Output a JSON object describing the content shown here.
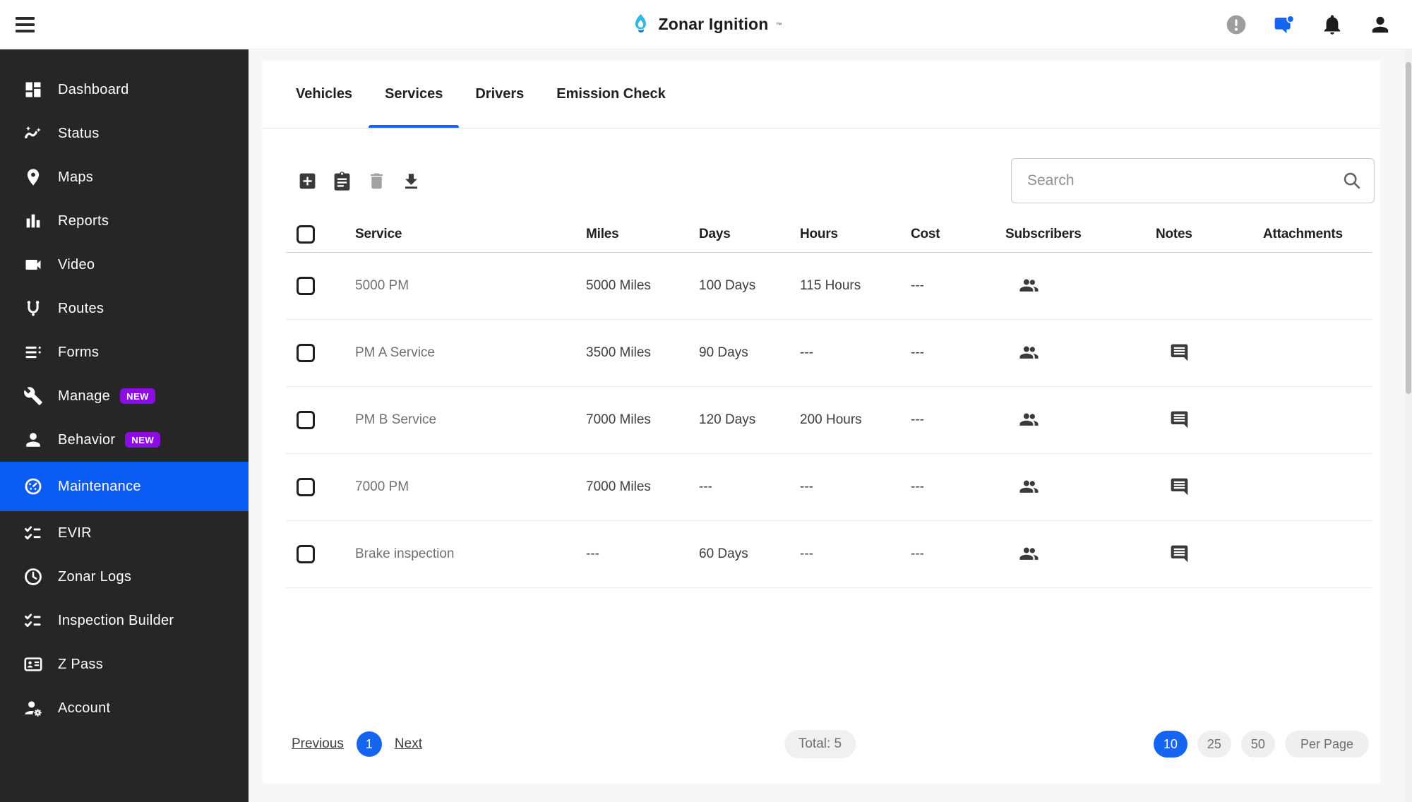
{
  "colors": {
    "sidebar_bg": "#262626",
    "active_item_blue": "#0b5bf5",
    "accent_blue": "#1565f0",
    "badge_purple": "#8c0ce4",
    "page_bg": "#f7f7f7"
  },
  "header": {
    "brand": "Zonar Ignition",
    "brand_mark": "™",
    "icons": [
      "menu-icon",
      "alert-icon",
      "chat-icon",
      "notifications-icon",
      "account-icon"
    ]
  },
  "sidebar": {
    "items": [
      {
        "label": "Dashboard",
        "icon": "dashboard-icon"
      },
      {
        "label": "Status",
        "icon": "status-icon"
      },
      {
        "label": "Maps",
        "icon": "map-pin-icon"
      },
      {
        "label": "Reports",
        "icon": "bar-chart-icon"
      },
      {
        "label": "Video",
        "icon": "video-camera-icon"
      },
      {
        "label": "Routes",
        "icon": "route-icon"
      },
      {
        "label": "Forms",
        "icon": "forms-list-icon"
      },
      {
        "label": "Manage",
        "icon": "wrench-icon",
        "badge": "NEW"
      },
      {
        "label": "Behavior",
        "icon": "person-icon",
        "badge": "NEW"
      },
      {
        "label": "Maintenance",
        "icon": "gauge-icon",
        "active": true
      },
      {
        "label": "EVIR",
        "icon": "checklist-icon"
      },
      {
        "label": "Zonar Logs",
        "icon": "clock-icon"
      },
      {
        "label": "Inspection Builder",
        "icon": "checklist-icon"
      },
      {
        "label": "Z Pass",
        "icon": "id-card-icon"
      },
      {
        "label": "Account",
        "icon": "person-gear-icon"
      }
    ]
  },
  "main": {
    "tabs": [
      {
        "label": "Vehicles"
      },
      {
        "label": "Services",
        "active": true
      },
      {
        "label": "Drivers"
      },
      {
        "label": "Emission Check"
      }
    ],
    "toolbar": {
      "icons": [
        "add-icon",
        "clipboard-icon",
        "trash-icon",
        "download-icon"
      ]
    },
    "search": {
      "placeholder": "Search"
    },
    "table": {
      "columns": [
        "Service",
        "Miles",
        "Days",
        "Hours",
        "Cost",
        "Subscribers",
        "Notes",
        "Attachments"
      ],
      "rows": [
        {
          "service": "5000 PM",
          "miles": "5000 Miles",
          "days": "100 Days",
          "hours": "115 Hours",
          "cost": "---",
          "has_subscribers": true,
          "has_notes": false,
          "has_attachments": false
        },
        {
          "service": "PM A Service",
          "miles": "3500 Miles",
          "days": "90 Days",
          "hours": "---",
          "cost": "---",
          "has_subscribers": true,
          "has_notes": true,
          "has_attachments": false
        },
        {
          "service": "PM B Service",
          "miles": "7000 Miles",
          "days": "120 Days",
          "hours": "200 Hours",
          "cost": "---",
          "has_subscribers": true,
          "has_notes": true,
          "has_attachments": false
        },
        {
          "service": "7000 PM",
          "miles": "7000 Miles",
          "days": "---",
          "hours": "---",
          "cost": "---",
          "has_subscribers": true,
          "has_notes": true,
          "has_attachments": false
        },
        {
          "service": "Brake inspection",
          "miles": "---",
          "days": "60 Days",
          "hours": "---",
          "cost": "---",
          "has_subscribers": true,
          "has_notes": true,
          "has_attachments": false
        }
      ]
    },
    "pagination": {
      "previous": "Previous",
      "current_page": "1",
      "next": "Next",
      "total": "Total: 5",
      "page_sizes": [
        "10",
        "25",
        "50"
      ],
      "active_page_size": "10",
      "per_page": "Per Page"
    }
  }
}
